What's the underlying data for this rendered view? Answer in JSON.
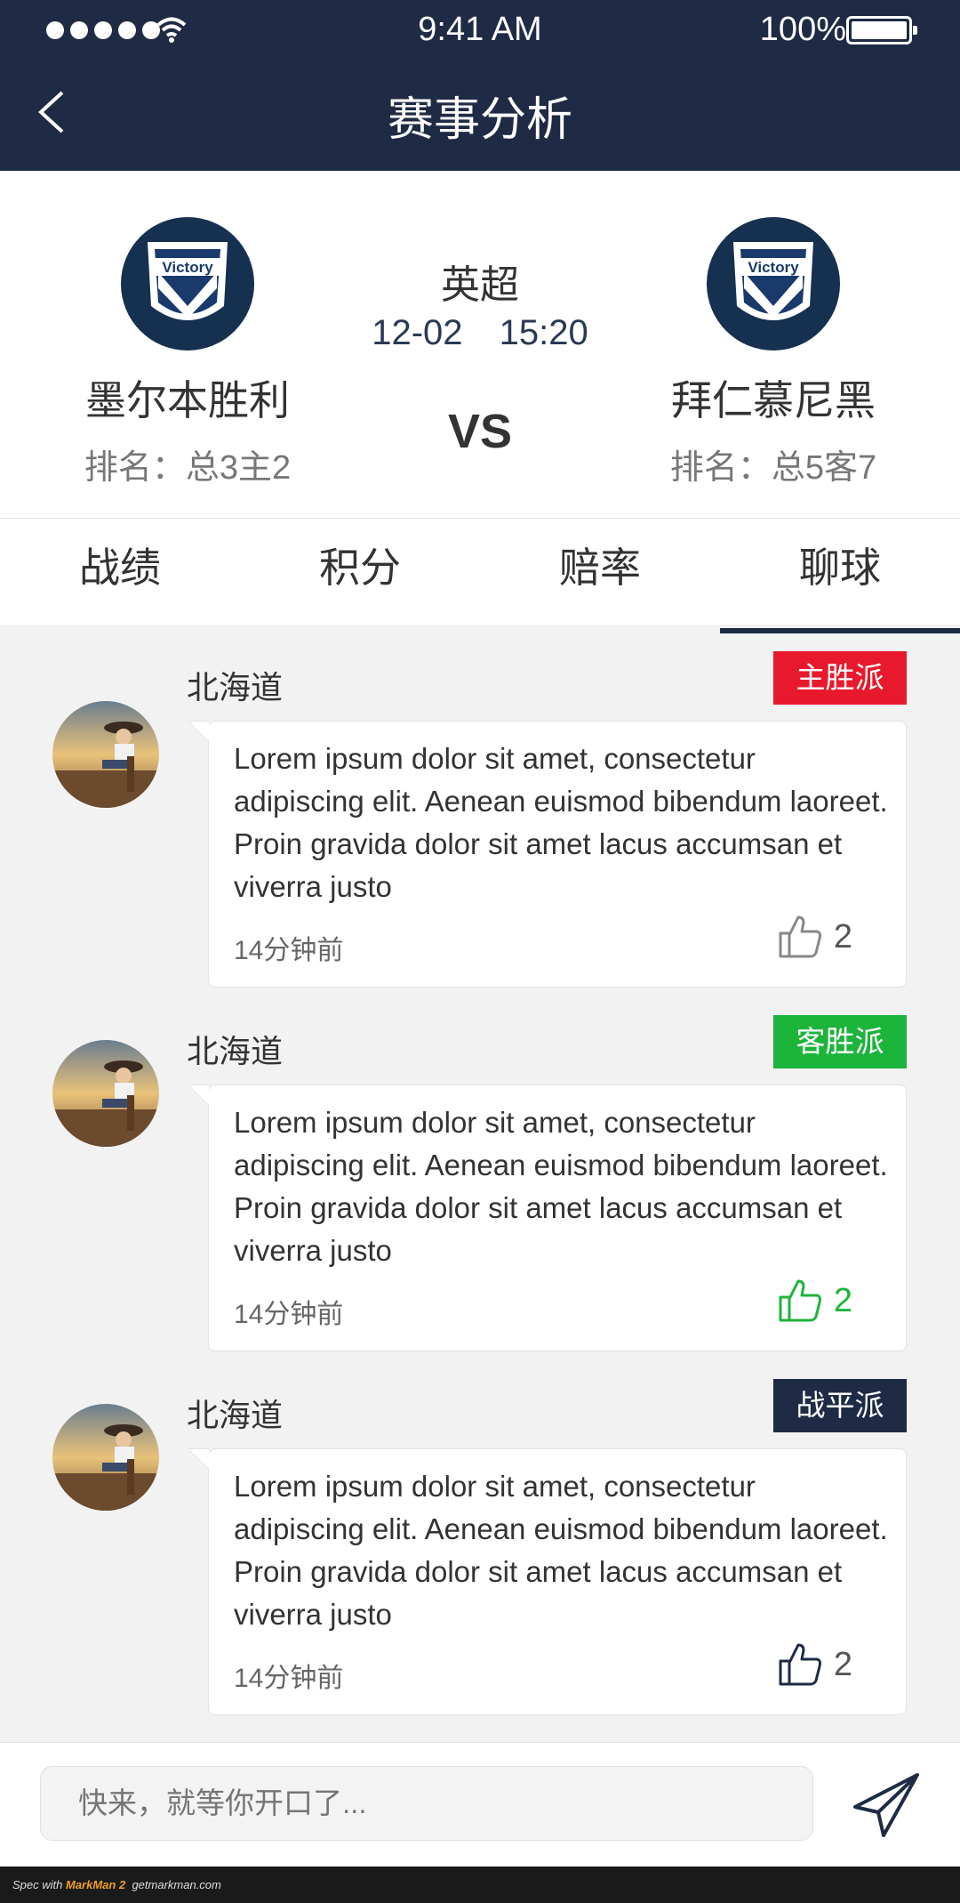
{
  "status_bar": {
    "time": "9:41 AM",
    "battery": "100%"
  },
  "header": {
    "title": "赛事分析"
  },
  "match": {
    "league": "英超",
    "date": "12-02",
    "time": "15:20",
    "vs": "VS",
    "home": {
      "name": "墨尔本胜利",
      "rank": "排名：总3主2",
      "logo_text": "Victory"
    },
    "away": {
      "name": "拜仁慕尼黑",
      "rank": "排名：总5客7",
      "logo_text": "Victory"
    }
  },
  "tabs": [
    "战绩",
    "积分",
    "赔率",
    "聊球"
  ],
  "active_tab": "聊球",
  "comments": [
    {
      "user": "北海道",
      "badge": "主胜派",
      "badge_color": "#e8192c",
      "text": "Lorem ipsum dolor sit amet, consectetur adipiscing elit. Aenean euismod bibendum laoreet. Proin gravida dolor sit amet lacus accumsan et viverra justo",
      "ago": "14分钟前",
      "likes": "2",
      "liked": false
    },
    {
      "user": "北海道",
      "badge": "客胜派",
      "badge_color": "#1db43c",
      "text": "Lorem ipsum dolor sit amet, consectetur adipiscing elit. Aenean euismod bibendum laoreet. Proin gravida dolor sit amet lacus accumsan et viverra justo",
      "ago": "14分钟前",
      "likes": "2",
      "liked": true
    },
    {
      "user": "北海道",
      "badge": "战平派",
      "badge_color": "#1f2b45",
      "text": "Lorem ipsum dolor sit amet, consectetur adipiscing elit. Aenean euismod bibendum laoreet. Proin gravida dolor sit amet lacus accumsan et viverra justo",
      "ago": "14分钟前",
      "likes": "2",
      "liked": false
    }
  ],
  "input": {
    "placeholder": "快来，就等你开口了..."
  },
  "footer": {
    "brand_prefix": "Spec with",
    "brand": "MarkMan 2",
    "site": "getmarkman.com"
  },
  "colors": {
    "nav_bg": "#1f2b45",
    "like_active": "#1db43c"
  }
}
